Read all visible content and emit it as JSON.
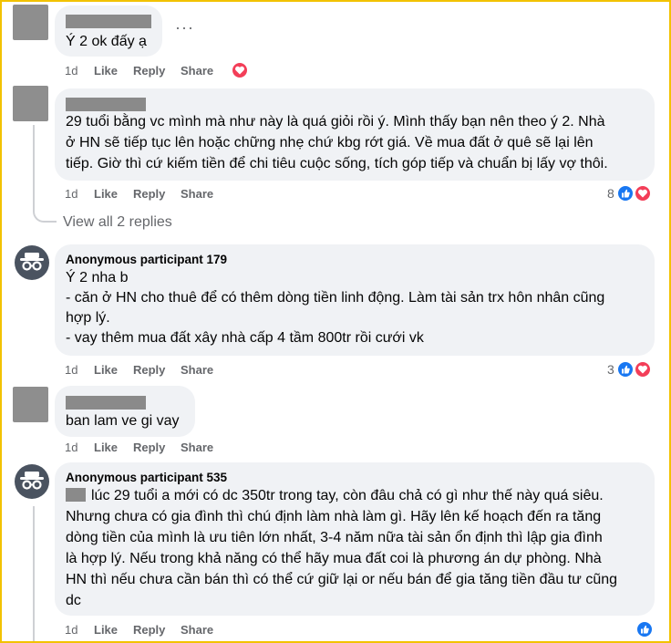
{
  "comments": [
    {
      "lines": [
        "Ý 2 ok đấy ạ"
      ],
      "time": "1d",
      "like": "Like",
      "reply": "Reply",
      "share": "Share",
      "more": "···"
    },
    {
      "lines": [
        "29 tuổi bằng vc mình mà như này là quá giỏi rồi ý. Mình thấy bạn nên theo ý 2. Nhà",
        "ở HN sẽ tiếp tục lên hoặc chững nhẹ chứ kbg rớt giá. Về mua đất ở quê sẽ lại lên",
        "tiếp. Giờ thì cứ kiếm tiền để chi tiêu cuộc sống, tích góp tiếp và chuẩn bị lấy vợ thôi."
      ],
      "time": "1d",
      "like": "Like",
      "reply": "Reply",
      "share": "Share",
      "reaction_count": "8",
      "view_replies": "View all 2 replies"
    },
    {
      "author": "Anonymous participant 179",
      "lines": [
        "Ý 2 nha b",
        "- căn ở HN cho thuê để có thêm dòng tiền linh động. Làm tài sản trx hôn nhân cũng",
        "hợp lý.",
        "- vay thêm mua đất xây nhà cấp 4 tầm 800tr rồi cưới vk"
      ],
      "time": "1d",
      "like": "Like",
      "reply": "Reply",
      "share": "Share",
      "reaction_count": "3"
    },
    {
      "lines": [
        "ban lam ve gi vay"
      ],
      "time": "1d",
      "like": "Like",
      "reply": "Reply",
      "share": "Share"
    },
    {
      "author": "Anonymous participant 535",
      "first_line": "lúc 29 tuổi a mới có dc 350tr trong tay, còn đâu chả có gì như thế này quá siêu.",
      "lines": [
        "Nhưng chưa có gia đình thì chú định làm nhà làm gì. Hãy lên kế hoạch đến ra tăng",
        "dòng tiền của mình là ưu tiên lớn nhất, 3-4 năm nữa tài sản ổn định thì lập gia đình",
        "là hợp lý. Nếu trong khả năng có thể hãy mua đất coi là phương án dự phòng. Nhà",
        "HN thì nếu chưa cần bán thì có thể cứ giữ lại or nếu bán để gia tăng tiền đầu tư cũng",
        "dc"
      ],
      "time": "1d",
      "like": "Like",
      "reply": "Reply",
      "share": "Share"
    }
  ],
  "colors": {
    "like_blue": "#1877f2",
    "love_red": "#f33e58",
    "bubble": "#f0f2f5",
    "meta_gray": "#65676b"
  }
}
